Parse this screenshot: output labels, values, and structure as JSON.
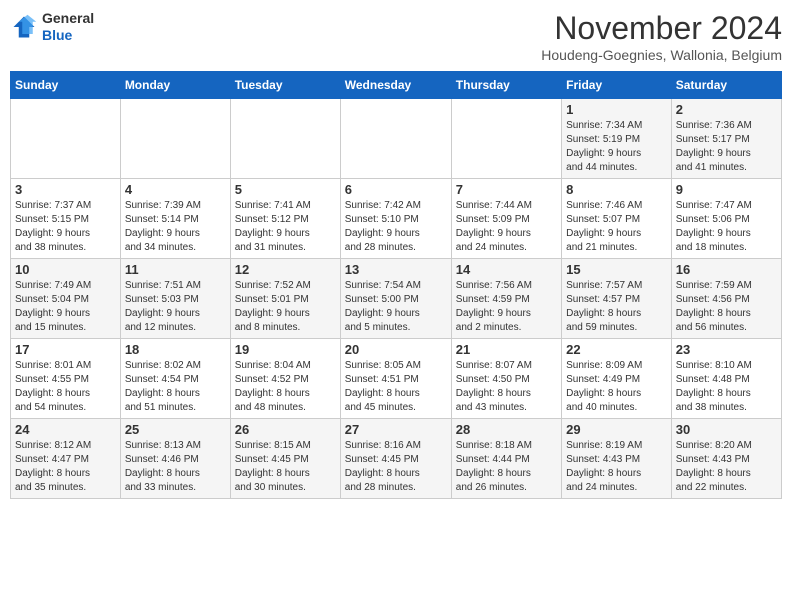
{
  "logo": {
    "general": "General",
    "blue": "Blue"
  },
  "header": {
    "month_title": "November 2024",
    "subtitle": "Houdeng-Goegnies, Wallonia, Belgium"
  },
  "weekdays": [
    "Sunday",
    "Monday",
    "Tuesday",
    "Wednesday",
    "Thursday",
    "Friday",
    "Saturday"
  ],
  "weeks": [
    [
      {
        "day": "",
        "info": ""
      },
      {
        "day": "",
        "info": ""
      },
      {
        "day": "",
        "info": ""
      },
      {
        "day": "",
        "info": ""
      },
      {
        "day": "",
        "info": ""
      },
      {
        "day": "1",
        "info": "Sunrise: 7:34 AM\nSunset: 5:19 PM\nDaylight: 9 hours\nand 44 minutes."
      },
      {
        "day": "2",
        "info": "Sunrise: 7:36 AM\nSunset: 5:17 PM\nDaylight: 9 hours\nand 41 minutes."
      }
    ],
    [
      {
        "day": "3",
        "info": "Sunrise: 7:37 AM\nSunset: 5:15 PM\nDaylight: 9 hours\nand 38 minutes."
      },
      {
        "day": "4",
        "info": "Sunrise: 7:39 AM\nSunset: 5:14 PM\nDaylight: 9 hours\nand 34 minutes."
      },
      {
        "day": "5",
        "info": "Sunrise: 7:41 AM\nSunset: 5:12 PM\nDaylight: 9 hours\nand 31 minutes."
      },
      {
        "day": "6",
        "info": "Sunrise: 7:42 AM\nSunset: 5:10 PM\nDaylight: 9 hours\nand 28 minutes."
      },
      {
        "day": "7",
        "info": "Sunrise: 7:44 AM\nSunset: 5:09 PM\nDaylight: 9 hours\nand 24 minutes."
      },
      {
        "day": "8",
        "info": "Sunrise: 7:46 AM\nSunset: 5:07 PM\nDaylight: 9 hours\nand 21 minutes."
      },
      {
        "day": "9",
        "info": "Sunrise: 7:47 AM\nSunset: 5:06 PM\nDaylight: 9 hours\nand 18 minutes."
      }
    ],
    [
      {
        "day": "10",
        "info": "Sunrise: 7:49 AM\nSunset: 5:04 PM\nDaylight: 9 hours\nand 15 minutes."
      },
      {
        "day": "11",
        "info": "Sunrise: 7:51 AM\nSunset: 5:03 PM\nDaylight: 9 hours\nand 12 minutes."
      },
      {
        "day": "12",
        "info": "Sunrise: 7:52 AM\nSunset: 5:01 PM\nDaylight: 9 hours\nand 8 minutes."
      },
      {
        "day": "13",
        "info": "Sunrise: 7:54 AM\nSunset: 5:00 PM\nDaylight: 9 hours\nand 5 minutes."
      },
      {
        "day": "14",
        "info": "Sunrise: 7:56 AM\nSunset: 4:59 PM\nDaylight: 9 hours\nand 2 minutes."
      },
      {
        "day": "15",
        "info": "Sunrise: 7:57 AM\nSunset: 4:57 PM\nDaylight: 8 hours\nand 59 minutes."
      },
      {
        "day": "16",
        "info": "Sunrise: 7:59 AM\nSunset: 4:56 PM\nDaylight: 8 hours\nand 56 minutes."
      }
    ],
    [
      {
        "day": "17",
        "info": "Sunrise: 8:01 AM\nSunset: 4:55 PM\nDaylight: 8 hours\nand 54 minutes."
      },
      {
        "day": "18",
        "info": "Sunrise: 8:02 AM\nSunset: 4:54 PM\nDaylight: 8 hours\nand 51 minutes."
      },
      {
        "day": "19",
        "info": "Sunrise: 8:04 AM\nSunset: 4:52 PM\nDaylight: 8 hours\nand 48 minutes."
      },
      {
        "day": "20",
        "info": "Sunrise: 8:05 AM\nSunset: 4:51 PM\nDaylight: 8 hours\nand 45 minutes."
      },
      {
        "day": "21",
        "info": "Sunrise: 8:07 AM\nSunset: 4:50 PM\nDaylight: 8 hours\nand 43 minutes."
      },
      {
        "day": "22",
        "info": "Sunrise: 8:09 AM\nSunset: 4:49 PM\nDaylight: 8 hours\nand 40 minutes."
      },
      {
        "day": "23",
        "info": "Sunrise: 8:10 AM\nSunset: 4:48 PM\nDaylight: 8 hours\nand 38 minutes."
      }
    ],
    [
      {
        "day": "24",
        "info": "Sunrise: 8:12 AM\nSunset: 4:47 PM\nDaylight: 8 hours\nand 35 minutes."
      },
      {
        "day": "25",
        "info": "Sunrise: 8:13 AM\nSunset: 4:46 PM\nDaylight: 8 hours\nand 33 minutes."
      },
      {
        "day": "26",
        "info": "Sunrise: 8:15 AM\nSunset: 4:45 PM\nDaylight: 8 hours\nand 30 minutes."
      },
      {
        "day": "27",
        "info": "Sunrise: 8:16 AM\nSunset: 4:45 PM\nDaylight: 8 hours\nand 28 minutes."
      },
      {
        "day": "28",
        "info": "Sunrise: 8:18 AM\nSunset: 4:44 PM\nDaylight: 8 hours\nand 26 minutes."
      },
      {
        "day": "29",
        "info": "Sunrise: 8:19 AM\nSunset: 4:43 PM\nDaylight: 8 hours\nand 24 minutes."
      },
      {
        "day": "30",
        "info": "Sunrise: 8:20 AM\nSunset: 4:43 PM\nDaylight: 8 hours\nand 22 minutes."
      }
    ]
  ]
}
